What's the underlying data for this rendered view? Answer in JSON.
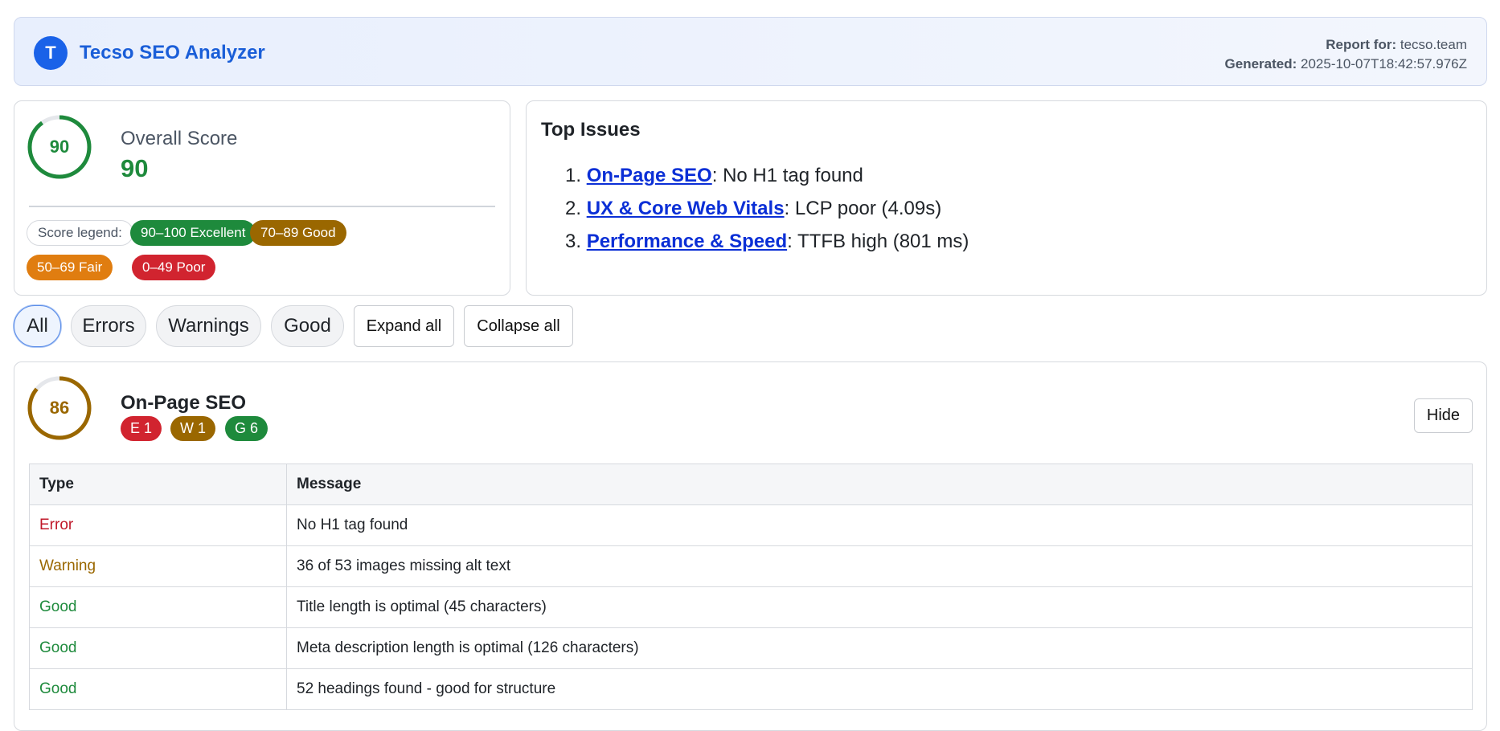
{
  "header": {
    "logo_letter": "T",
    "app_title": "Tecso SEO Analyzer",
    "report_for_label": "Report for:",
    "report_for_value": "tecso.team",
    "generated_label": "Generated:",
    "generated_value": "2025-10-07T18:42:57.976Z"
  },
  "overall": {
    "score": 90,
    "score_text": "90",
    "label": "Overall Score",
    "value_text": "90",
    "color": "#1e8a3c"
  },
  "legend": {
    "label": "Score legend:",
    "items": [
      {
        "text": "90–100 Excellent",
        "color": "#1e8a3c"
      },
      {
        "text": "70–89 Good",
        "color": "#9a6700"
      },
      {
        "text": "50–69 Fair",
        "color": "#e07d10"
      },
      {
        "text": "0–49 Poor",
        "color": "#d1242f"
      }
    ]
  },
  "top_issues": {
    "title": "Top Issues",
    "items": [
      {
        "num": "1.",
        "link": "On-Page SEO",
        "text": ": No H1 tag found"
      },
      {
        "num": "2.",
        "link": "UX & Core Web Vitals",
        "text": ": LCP poor (4.09s)"
      },
      {
        "num": "3.",
        "link": "Performance & Speed",
        "text": ": TTFB high (801 ms)"
      }
    ]
  },
  "filters": {
    "all": "All",
    "errors": "Errors",
    "warnings": "Warnings",
    "good": "Good",
    "expand_all": "Expand all",
    "collapse_all": "Collapse all",
    "active": "All"
  },
  "section": {
    "title": "On-Page SEO",
    "score": 86,
    "score_text": "86",
    "color": "#9a6700",
    "badges": {
      "errors": "E 1",
      "warnings": "W 1",
      "good": "G 6"
    },
    "hide_label": "Hide",
    "table": {
      "headers": {
        "type": "Type",
        "message": "Message"
      },
      "rows": [
        {
          "type": "Error",
          "message": "No H1 tag found"
        },
        {
          "type": "Warning",
          "message": "36 of 53 images missing alt text"
        },
        {
          "type": "Good",
          "message": "Title length is optimal (45 characters)"
        },
        {
          "type": "Good",
          "message": "Meta description length is optimal (126 characters)"
        },
        {
          "type": "Good",
          "message": "52 headings found - good for structure"
        }
      ]
    }
  }
}
